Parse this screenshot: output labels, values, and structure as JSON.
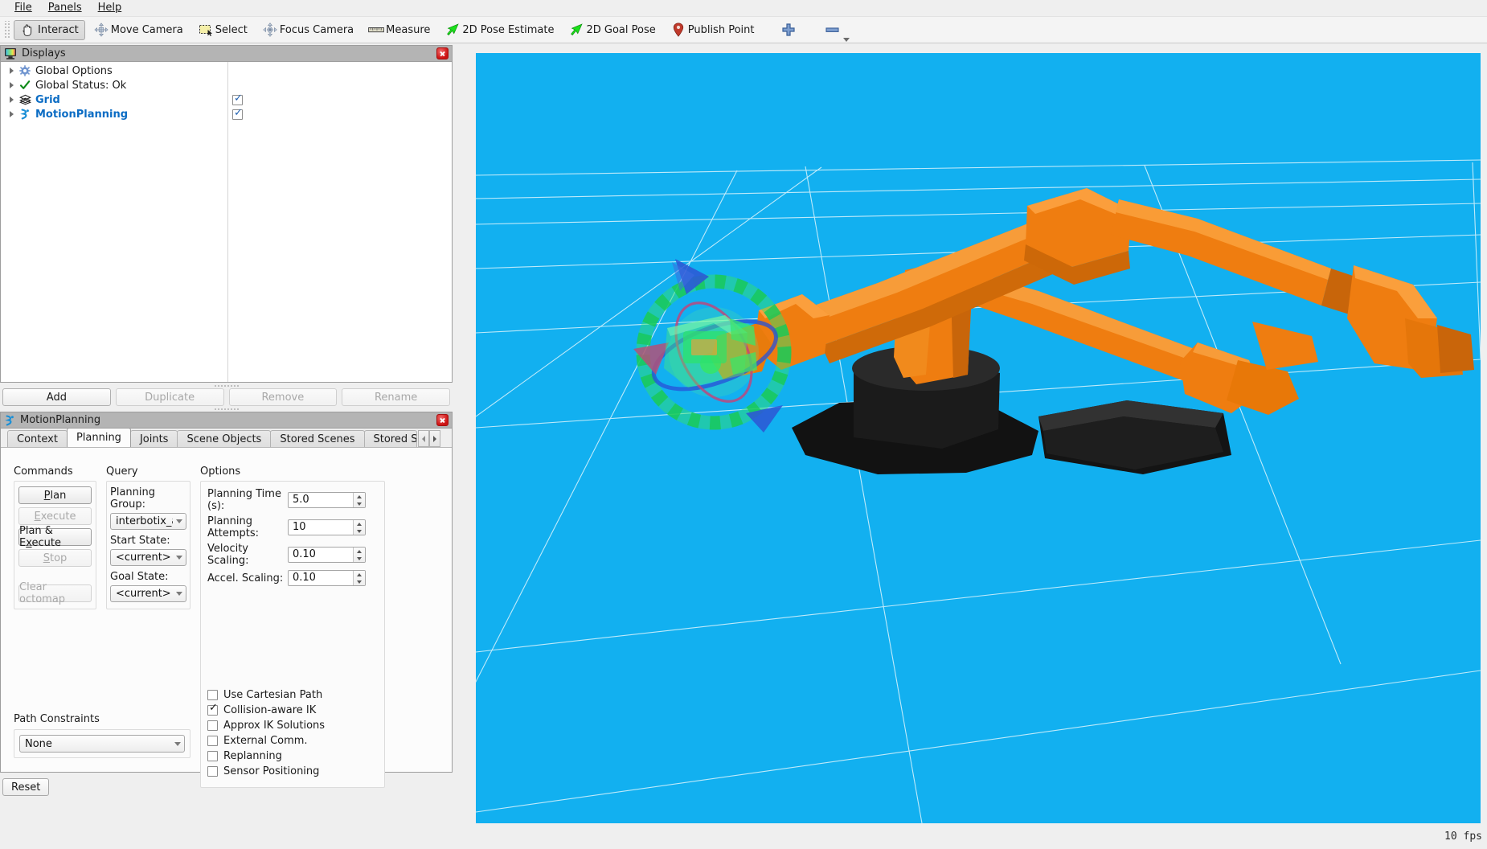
{
  "menu": {
    "items": [
      {
        "label": "File",
        "mnemonic": "F"
      },
      {
        "label": "Panels",
        "mnemonic": "P"
      },
      {
        "label": "Help",
        "mnemonic": "H"
      }
    ]
  },
  "toolbar": {
    "buttons": [
      {
        "label": "Interact",
        "icon": "hand-cursor-icon",
        "checked": true
      },
      {
        "label": "Move Camera",
        "icon": "move-camera-icon",
        "checked": false
      },
      {
        "label": "Select",
        "icon": "select-rect-icon",
        "checked": false
      },
      {
        "label": "Focus Camera",
        "icon": "focus-camera-icon",
        "checked": false
      },
      {
        "label": "Measure",
        "icon": "ruler-icon",
        "checked": false
      },
      {
        "label": "2D Pose Estimate",
        "icon": "green-arrow-icon",
        "checked": false
      },
      {
        "label": "2D Goal Pose",
        "icon": "green-arrow-icon",
        "checked": false
      },
      {
        "label": "Publish Point",
        "icon": "map-pin-icon",
        "checked": false
      }
    ],
    "add_tool_label": "",
    "remove_tool_label": ""
  },
  "displays_panel": {
    "title": "Displays",
    "title_icon": "displays-monitor-icon",
    "close_icon": "close-icon",
    "tree": [
      {
        "label": "Global Options",
        "icon": "gear-icon",
        "bold": false,
        "has_checkbox": false,
        "checked": false
      },
      {
        "label": "Global Status: Ok",
        "icon": "check-icon",
        "bold": false,
        "has_checkbox": false,
        "checked": false
      },
      {
        "label": "Grid",
        "icon": "grid-icon",
        "bold": true,
        "has_checkbox": true,
        "checked": true
      },
      {
        "label": "MotionPlanning",
        "icon": "motionplanning-icon",
        "bold": true,
        "has_checkbox": true,
        "checked": true
      }
    ],
    "buttons": [
      {
        "label": "Add",
        "enabled": true
      },
      {
        "label": "Duplicate",
        "enabled": false
      },
      {
        "label": "Remove",
        "enabled": false
      },
      {
        "label": "Rename",
        "enabled": false
      }
    ]
  },
  "motion_planning_panel": {
    "title": "MotionPlanning",
    "title_icon": "motionplanning-icon",
    "close_icon": "close-icon",
    "tabs": [
      {
        "label": "Context",
        "active": false
      },
      {
        "label": "Planning",
        "active": true
      },
      {
        "label": "Joints",
        "active": false
      },
      {
        "label": "Scene Objects",
        "active": false
      },
      {
        "label": "Stored Scenes",
        "active": false
      },
      {
        "label": "Stored State",
        "active": false
      }
    ],
    "tab_scroll_left": "scroll-left-arrow-icon",
    "tab_scroll_right": "scroll-right-arrow-icon",
    "commands": {
      "group_label": "Commands",
      "buttons": [
        {
          "label": "Plan",
          "mnemonic": "P",
          "enabled": true
        },
        {
          "label": "Execute",
          "mnemonic": "E",
          "enabled": false
        },
        {
          "label": "Plan & Execute",
          "mnemonic": "x",
          "enabled": true
        },
        {
          "label": "Stop",
          "mnemonic": "S",
          "enabled": false
        },
        {
          "label": "Clear octomap",
          "mnemonic": "",
          "enabled": false
        }
      ]
    },
    "query": {
      "group_label": "Query",
      "planning_group_label": "Planning Group:",
      "planning_group_value": "interbotix_arm",
      "start_state_label": "Start State:",
      "start_state_value": "<current>",
      "goal_state_label": "Goal State:",
      "goal_state_value": "<current>"
    },
    "options": {
      "group_label": "Options",
      "fields": [
        {
          "label": "Planning Time (s):",
          "value": "5.0"
        },
        {
          "label": "Planning Attempts:",
          "value": "10"
        },
        {
          "label": "Velocity Scaling:",
          "value": "0.10"
        },
        {
          "label": "Accel. Scaling:",
          "value": "0.10"
        }
      ],
      "checkboxes": [
        {
          "label": "Use Cartesian Path",
          "checked": false
        },
        {
          "label": "Collision-aware IK",
          "checked": true
        },
        {
          "label": "Approx IK Solutions",
          "checked": false
        },
        {
          "label": "External Comm.",
          "checked": false
        },
        {
          "label": "Replanning",
          "checked": false
        },
        {
          "label": "Sensor Positioning",
          "checked": false
        }
      ]
    },
    "path_constraints": {
      "label": "Path Constraints",
      "value": "None"
    }
  },
  "status_bar": {
    "fps": "10 fps",
    "reset_label": "Reset"
  },
  "viewport": {
    "background_color": "#12b0f0",
    "grid_line_color": "#c9eefb",
    "robot_color": "#ef7d10",
    "base_color": "#1d1d1d",
    "marker_ring_color": "#2fe36a",
    "collapse_left_icon": "collapse-left-arrow-icon",
    "collapse_right_icon": "collapse-right-arrow-icon"
  }
}
